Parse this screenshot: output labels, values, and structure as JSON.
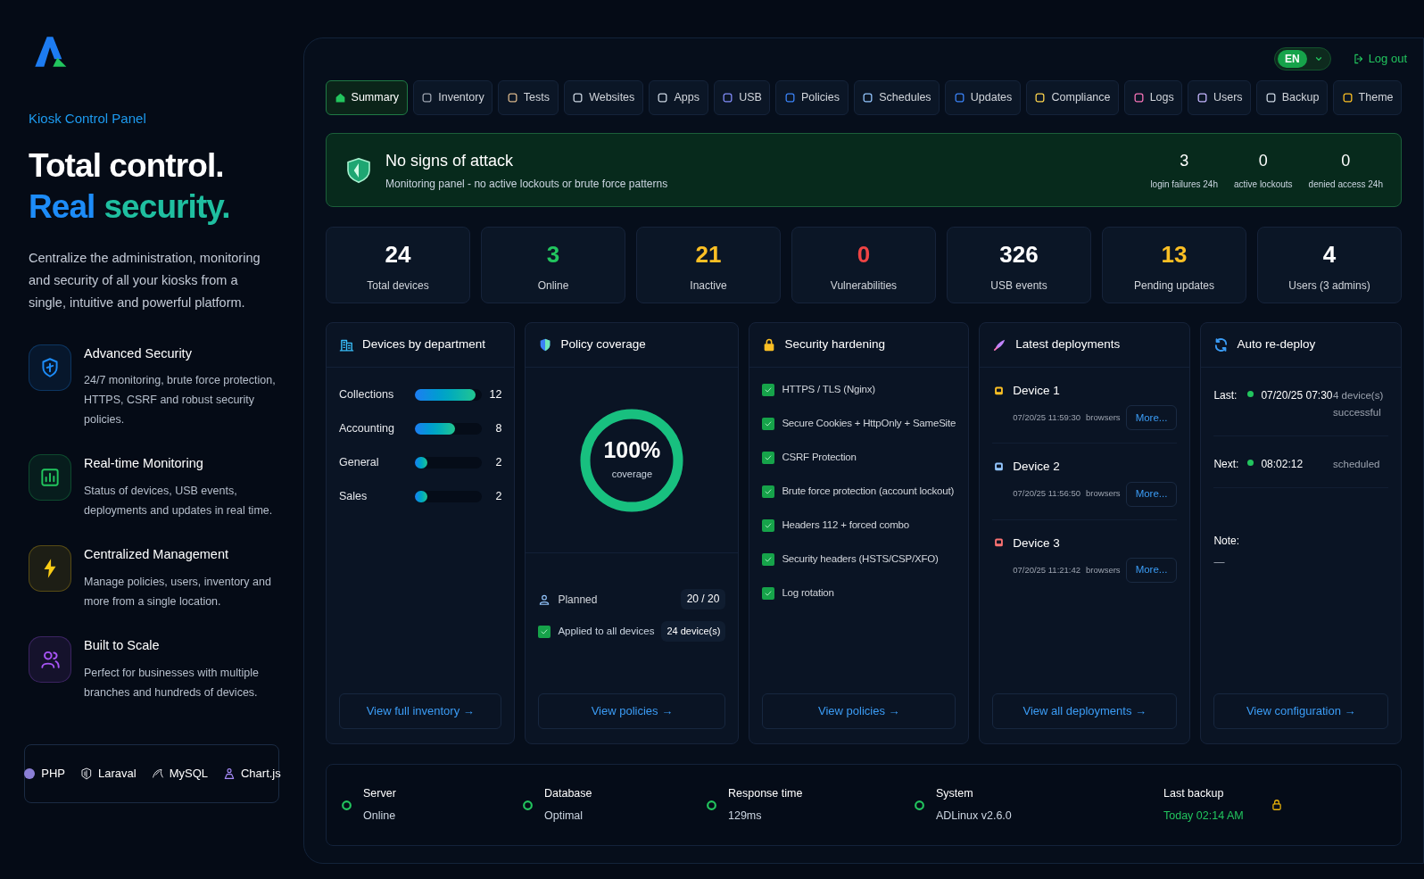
{
  "brand": {
    "tagline": "Kiosk Control Panel",
    "headline_1": "Total control.",
    "headline_2a": "Real",
    "headline_2b": "security.",
    "intro": "Centralize the administration, monitoring and security of all your kiosks from a single, intuitive and powerful platform."
  },
  "features": [
    {
      "title": "Advanced Security",
      "text": "24/7 monitoring, brute force protection, HTTPS, CSRF and robust security policies.",
      "color": "#1d8cf8"
    },
    {
      "title": "Real-time Monitoring",
      "text": "Status of devices, USB events, deployments and updates in real time.",
      "color": "#22c55e"
    },
    {
      "title": "Centralized Management",
      "text": "Manage policies, users, inventory and more from a single location.",
      "color": "#facc15"
    },
    {
      "title": "Built to Scale",
      "text": "Perfect for businesses with multiple branches and hundreds of devices.",
      "color": "#a855f7"
    }
  ],
  "tech": [
    "PHP",
    "Laraval",
    "MySQL",
    "Chart.js"
  ],
  "header": {
    "language": "EN",
    "logout": "Log out"
  },
  "tabs": [
    {
      "label": "Summary",
      "selected": true
    },
    {
      "label": "Inventory",
      "selected": false
    },
    {
      "label": "Tests",
      "selected": false
    },
    {
      "label": "Websites",
      "selected": false
    },
    {
      "label": "Apps",
      "selected": false
    },
    {
      "label": "USB",
      "selected": false
    },
    {
      "label": "Policies",
      "selected": false
    },
    {
      "label": "Schedules",
      "selected": false
    },
    {
      "label": "Updates",
      "selected": false
    },
    {
      "label": "Compliance",
      "selected": false
    },
    {
      "label": "Logs",
      "selected": false
    },
    {
      "label": "Users",
      "selected": false
    },
    {
      "label": "Backup",
      "selected": false
    },
    {
      "label": "Theme",
      "selected": false
    }
  ],
  "alert": {
    "title": "No signs of attack",
    "text": "Monitoring panel - no active lockouts or brute force patterns",
    "counters": [
      {
        "value": "3",
        "label": "login failures 24h"
      },
      {
        "value": "0",
        "label": "active lockouts"
      },
      {
        "value": "0",
        "label": "denied access 24h"
      }
    ]
  },
  "stats": [
    {
      "value": "24",
      "label": "Total devices",
      "color": "#ffffff"
    },
    {
      "value": "3",
      "label": "Online",
      "color": "#22c55e"
    },
    {
      "value": "21",
      "label": "Inactive",
      "color": "#fbbf24"
    },
    {
      "value": "0",
      "label": "Vulnerabilities",
      "color": "#ef4444"
    },
    {
      "value": "326",
      "label": "USB events",
      "color": "#ffffff"
    },
    {
      "value": "13",
      "label": "Pending updates",
      "color": "#fbbf24"
    },
    {
      "value": "4",
      "label": "Users (3 admins)",
      "color": "#ffffff"
    }
  ],
  "departments": {
    "title": "Devices by department",
    "rows": [
      {
        "name": "Collections",
        "count": "12",
        "level": 0.9
      },
      {
        "name": "Accounting",
        "count": "8",
        "level": 0.6
      },
      {
        "name": "General",
        "count": "2",
        "level": 0.19
      },
      {
        "name": "Sales",
        "count": "2",
        "level": 0.19
      }
    ],
    "link": "View full inventory →"
  },
  "policy": {
    "title": "Policy coverage",
    "percent": "100%",
    "caption": "coverage",
    "level": 1,
    "planned_label": "Planned",
    "planned_value": "20 / 20",
    "applied_label": "Applied to all devices",
    "applied_checked": true,
    "applied_value": "24 device(s)",
    "link": "View policies →"
  },
  "hardening": {
    "title": "Security hardening",
    "items": [
      {
        "label": "HTTPS / TLS (Nginx)",
        "checked": true
      },
      {
        "label": "Secure Cookies + HttpOnly + SameSite",
        "checked": true
      },
      {
        "label": "CSRF Protection",
        "checked": true
      },
      {
        "label": "Brute force protection (account lockout)",
        "checked": true
      },
      {
        "label": "Headers 112 + forced combo",
        "checked": true
      },
      {
        "label": "Security headers (HSTS/CSP/XFO)",
        "checked": true
      },
      {
        "label": "Log rotation",
        "checked": true
      }
    ],
    "link": "View policies →"
  },
  "deployments": {
    "title": "Latest deployments",
    "items": [
      {
        "name": "Device 1",
        "time": "07/20/25 11:59:30",
        "tag": "browsers",
        "action": "More..."
      },
      {
        "name": "Device 2",
        "time": "07/20/25 11:56:50",
        "tag": "browsers",
        "action": "More..."
      },
      {
        "name": "Device 3",
        "time": "07/20/25 11:21:42",
        "tag": "browsers",
        "action": "More..."
      }
    ],
    "link": "View all deployments →"
  },
  "redeploy": {
    "title": "Auto re-deploy",
    "rows": [
      {
        "label": "Last:",
        "value": "07/20/25 07:30",
        "note": "4 device(s) successful"
      },
      {
        "label": "Next:",
        "value": "08:02:12",
        "note": "scheduled"
      }
    ],
    "note_label": "Note:",
    "note_value": "—",
    "link": "View configuration →"
  },
  "status_bar": [
    {
      "kind": "status",
      "label": "Server",
      "value": "Online"
    },
    {
      "kind": "status",
      "label": "Database",
      "value": "Optimal"
    },
    {
      "kind": "status",
      "label": "Response time",
      "value": "129ms"
    },
    {
      "kind": "status",
      "label": "System",
      "value": "ADLinux v2.6.0"
    },
    {
      "kind": "backup",
      "label": "Last backup",
      "value": "Today 02:14 AM"
    }
  ]
}
